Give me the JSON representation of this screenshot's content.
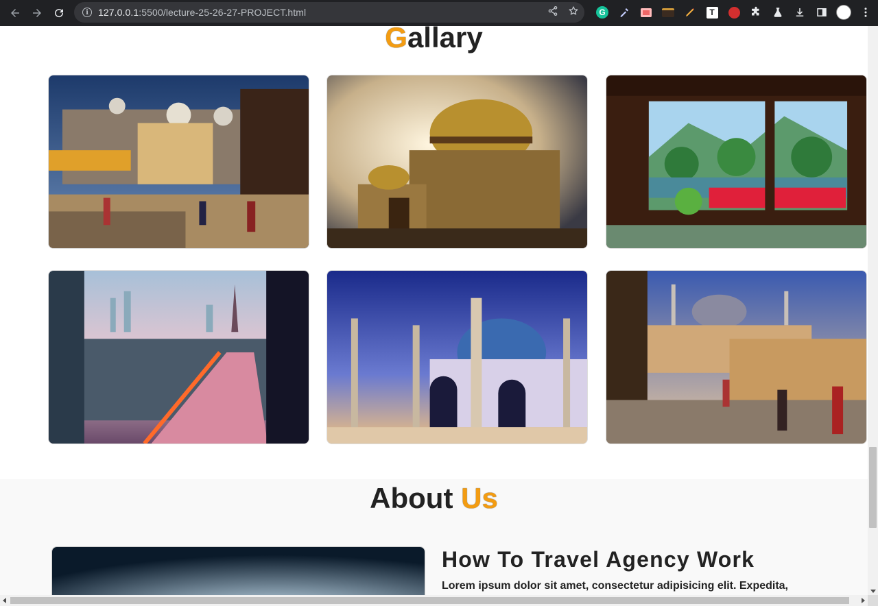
{
  "browser": {
    "url_host": "127.0.0.1",
    "url_rest": ":5500/lecture-25-26-27-PROJECT.html",
    "icons": [
      "back-icon",
      "forward-icon",
      "reload-icon",
      "site-info-icon",
      "share-icon",
      "bookmark-star-icon",
      "grammarly-extension-icon",
      "color-picker-extension-icon",
      "extension-icon",
      "extension-icon",
      "pencil-extension-icon",
      "text-extension-icon",
      "hand-stop-extension-icon",
      "puzzle-extensions-icon",
      "flask-labs-icon",
      "download-icon",
      "side-panel-icon",
      "profile-avatar",
      "menu-kebab-icon"
    ]
  },
  "gallery": {
    "heading_accent": "G",
    "heading_rest": "allary",
    "images": [
      {
        "subject": "old-city-market-with-palace"
      },
      {
        "subject": "golden-domed-palace"
      },
      {
        "subject": "japanese-garden-through-window"
      },
      {
        "subject": "paris-city-river-night"
      },
      {
        "subject": "blue-domed-mosque-sunset"
      },
      {
        "subject": "ottoman-market-with-mosque"
      }
    ]
  },
  "about": {
    "heading_main": "About",
    "heading_accent": "Us",
    "title": "How To Travel Agency Work",
    "text": "Lorem ipsum dolor sit amet, consectetur adipisicing elit. Expedita,"
  },
  "colors": {
    "accent": "#f39c12",
    "heading_text": "#222222",
    "chrome_bg": "#202124",
    "omnibox_bg": "#35363a"
  }
}
